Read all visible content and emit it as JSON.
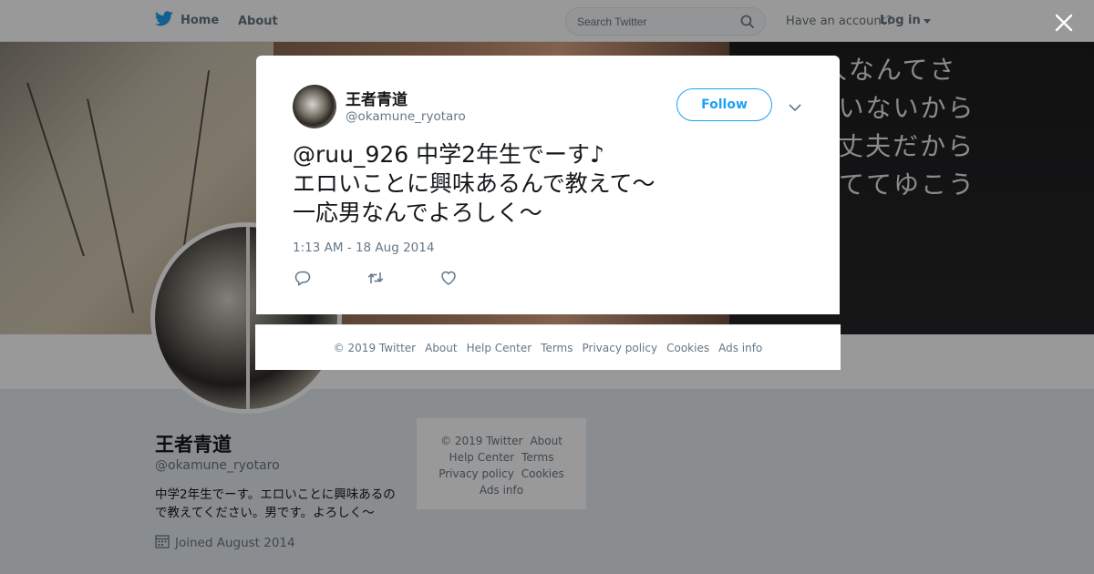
{
  "topnav": {
    "home_label": "Home",
    "about_label": "About",
    "search_placeholder": "Search Twitter",
    "have_account": "Have an account?",
    "login_label": "Log in"
  },
  "banner": {
    "lines": [
      "に勝  人なんてさ",
      "  一人もいないから",
      "いで大丈夫だから",
      "種を育ててゆこう"
    ]
  },
  "profile": {
    "name": "王者青道",
    "handle": "@okamune_ryotaro",
    "bio": "中学2年生でーす。エロいことに興味あるので教えてください。男です。よろしく～",
    "joined": "Joined August 2014"
  },
  "side_footer": {
    "copyright": "© 2019 Twitter",
    "about": "About",
    "help": "Help Center",
    "terms": "Terms",
    "privacy": "Privacy policy",
    "cookies": "Cookies",
    "ads": "Ads info"
  },
  "tweet": {
    "name": "王者青道",
    "handle": "@okamune_ryotaro",
    "follow_label": "Follow",
    "lines": [
      "@ruu_926 中学2年生でーす♪",
      "エロいことに興味あるんで教えて～",
      "一応男なんでよろしく～"
    ],
    "timestamp": "1:13 AM - 18 Aug 2014"
  },
  "modal_footer": {
    "copyright": "© 2019 Twitter",
    "about": "About",
    "help": "Help Center",
    "terms": "Terms",
    "privacy": "Privacy policy",
    "cookies": "Cookies",
    "ads": "Ads info"
  },
  "colors": {
    "brand": "#1da1f2",
    "muted": "#657786",
    "text": "#14171a"
  },
  "icons": [
    "twitter-bird-icon",
    "search-icon",
    "caret-down-icon",
    "close-icon",
    "reply-icon",
    "retweet-icon",
    "like-icon",
    "calendar-icon",
    "chevron-down-icon"
  ]
}
